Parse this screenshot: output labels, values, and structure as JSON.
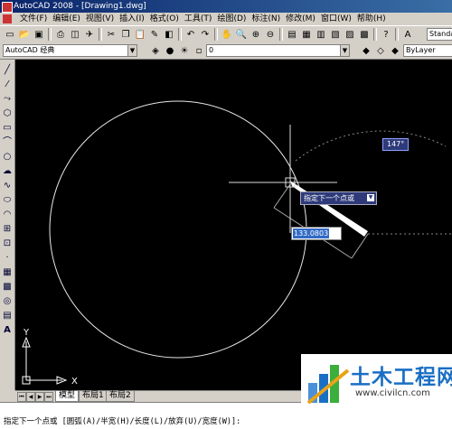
{
  "window": {
    "title": "AutoCAD 2008 - [Drawing1.dwg]"
  },
  "menu": [
    "文件(F)",
    "编辑(E)",
    "视图(V)",
    "插入(I)",
    "格式(O)",
    "工具(T)",
    "绘图(D)",
    "标注(N)",
    "修改(M)",
    "窗口(W)",
    "帮助(H)"
  ],
  "toolbar": {
    "style_combo": "Standa",
    "workspace": "AutoCAD 经典",
    "layer": "0",
    "linetype": "ByLayer"
  },
  "canvas": {
    "angle_tooltip": "147°",
    "prompt_tooltip": "指定下一个点或",
    "length_input": "133.0803",
    "ucs_x": "X",
    "ucs_y": "Y"
  },
  "tabs": [
    "模型",
    "布局1",
    "布局2"
  ],
  "command_line": "指定下一个点或 [圆弧(A)/半宽(H)/长度(L)/放弃(U)/宽度(W)]:",
  "watermark": {
    "title": "土木工程网",
    "url": "www.civilcn.com"
  }
}
